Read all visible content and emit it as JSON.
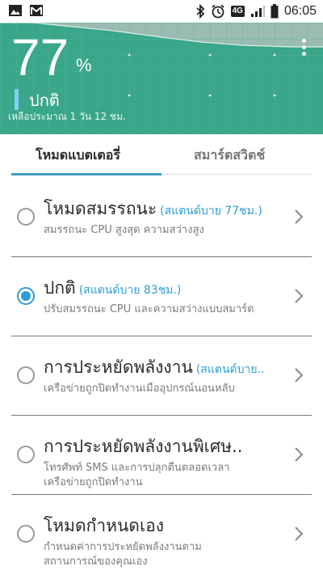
{
  "status_bar": {
    "time": "06:05",
    "network": "4G",
    "left_icons": [
      "image-icon",
      "gmail-icon"
    ],
    "right_icons": [
      "bluetooth-icon",
      "alarm-icon",
      "lte-icon",
      "signal-icon",
      "battery-icon"
    ]
  },
  "battery": {
    "percent": "77",
    "percent_sign": "%",
    "state": "ปกติ",
    "remaining": "เหลือประมาณ 1 วัน 12 ชม."
  },
  "tabs": [
    {
      "label": "โหมดแบตเตอรี่",
      "active": true
    },
    {
      "label": "สมาร์ตสวิตช์",
      "active": false
    }
  ],
  "modes": [
    {
      "title": "โหมดสมรรถนะ",
      "standby": "(สแตนด์บาย 77ชม.)",
      "desc": [
        "สมรรถนะ CPU สูงสุด ความสว่างสูง"
      ],
      "selected": false
    },
    {
      "title": "ปกติ",
      "standby": "(สแตนด์บาย 83ชม.)",
      "desc": [
        "ปรับสมรรถนะ CPU และความสว่างแบบสมาร์ต"
      ],
      "selected": true
    },
    {
      "title": "การประหยัดพลังงาน",
      "standby": "(สแตนด์บาย..",
      "desc": [
        "เครือข่ายถูกปิดทำงานเมื่ออุปกรณ์นอนหลับ"
      ],
      "selected": false
    },
    {
      "title": "การประหยัดพลังงานพิเศษ..",
      "standby": "",
      "desc": [
        "โทรศัพท์ SMS และการปลุกตื่นตลอดเวลา",
        "เครือข่ายถูกปิดทำงาน"
      ],
      "selected": false
    },
    {
      "title": "โหมดกำหนดเอง",
      "standby": "",
      "desc": [
        "กำหนดค่าการประหยัดพลังงานตาม",
        "สถานการณ์ของคุณเอง"
      ],
      "selected": false
    }
  ],
  "colors": {
    "header_green": "#3aa68a",
    "accent_blue": "#2c9ed6",
    "state_bar": "#7fd0f2"
  }
}
